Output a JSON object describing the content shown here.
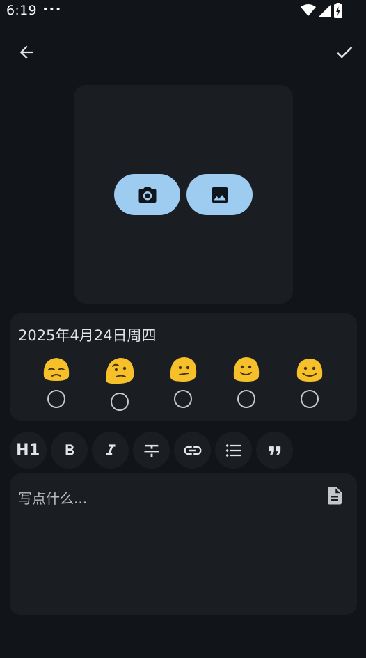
{
  "status_bar": {
    "time": "6:19",
    "overflow": "•••",
    "icons": [
      "wifi-icon",
      "cellular-signal-icon",
      "battery-charging-icon"
    ]
  },
  "app_bar": {
    "back_icon": "arrow-back-icon",
    "confirm_icon": "check-icon"
  },
  "photo_picker": {
    "camera_icon": "camera-icon",
    "gallery_icon": "image-icon",
    "button_color": "#9ecbf0"
  },
  "mood": {
    "date": "2025年4月24日周四",
    "options": [
      {
        "emoji": "😞",
        "icon": "sad-face-icon"
      },
      {
        "emoji": "🤔",
        "icon": "thinking-face-icon"
      },
      {
        "emoji": "🫤",
        "icon": "neutral-face-icon"
      },
      {
        "emoji": "🙂",
        "icon": "slight-smile-icon"
      },
      {
        "emoji": "😊",
        "icon": "happy-face-icon"
      }
    ]
  },
  "toolbar": {
    "h1_label": "H1",
    "tools": [
      "bold-icon",
      "italic-icon",
      "strikethrough-icon",
      "link-icon",
      "bullet-list-icon",
      "quote-icon"
    ]
  },
  "editor": {
    "placeholder": "写点什么...",
    "template_icon": "document-icon"
  },
  "colors": {
    "background": "#111418",
    "surface": "#1a1d21",
    "accent": "#9ecbf0",
    "emoji": "#f5c02a"
  }
}
